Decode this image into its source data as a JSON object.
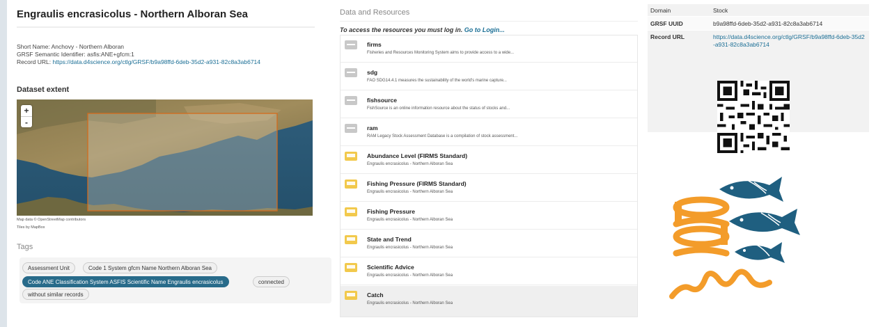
{
  "left": {
    "title": "Engraulis encrasicolus - Northern Alboran Sea",
    "short_name": "Short Name: Anchovy - Northern Alboran",
    "semantic_id": "GRSF Semantic Identifier: asfis:ANE+gfcm:1",
    "record_url_label": "Record URL: ",
    "record_url": "https://data.d4science.org/ctlg/GRSF/b9a98ffd-6deb-35d2-a931-82c8a3ab6714",
    "dataset_extent_heading": "Dataset extent",
    "zoom_in": "+",
    "zoom_out": "-",
    "map_attribution": "Map data © OpenStreetMap contributors",
    "tiles_attribution": "Tiles by MapBox",
    "tags_heading": "Tags",
    "tags": [
      "Assessment Unit",
      "Code 1 System gfcm Name Northern Alboran Sea",
      "Code ANE Classification System ASFIS Scientific Name Engraulis encrasicolus",
      "connected",
      "without similar records"
    ]
  },
  "middle": {
    "heading": "Data and Resources",
    "login_text": "To access the resources you must log in.",
    "login_link": "Go to Login...",
    "resources": [
      {
        "title": "firms",
        "desc": "Fisheries and Resources Monitoring System aims to provide access to a wide...",
        "icon": "grey-doc-icon"
      },
      {
        "title": "sdg",
        "desc": "FAO SDG14.4.1 measures the sustainability of the world's marine capture...",
        "icon": "grey-doc-icon"
      },
      {
        "title": "fishsource",
        "desc": "FishSource is an online information resource about the status of stocks and...",
        "icon": "grey-doc-icon"
      },
      {
        "title": "ram",
        "desc": "RAM Legacy Stock Assessment Database is a compilation of stock assessment...",
        "icon": "grey-doc-icon"
      },
      {
        "title": "Abundance Level (FIRMS Standard)",
        "desc": "Engraulis encrasicolus - Northern Alboran Sea",
        "icon": "yellow-doc-icon"
      },
      {
        "title": "Fishing Pressure (FIRMS Standard)",
        "desc": "Engraulis encrasicolus - Northern Alboran Sea",
        "icon": "yellow-doc-icon"
      },
      {
        "title": "Fishing Pressure",
        "desc": "Engraulis encrasicolus - Northern Alboran Sea",
        "icon": "yellow-doc-icon"
      },
      {
        "title": "State and Trend",
        "desc": "Engraulis encrasicolus - Northern Alboran Sea",
        "icon": "yellow-doc-icon"
      },
      {
        "title": "Scientific Advice",
        "desc": "Engraulis encrasicolus - Northern Alboran Sea",
        "icon": "yellow-doc-icon"
      },
      {
        "title": "Catch",
        "desc": "Engraulis encrasicolus - Northern Alboran Sea",
        "icon": "yellow-doc-icon"
      }
    ]
  },
  "right": {
    "domain_label": "Domain",
    "domain_value": "Stock",
    "uuid_label": "GRSF UUID",
    "uuid_value": "b9a98ffd-6deb-35d2-a931-82c8a3ab6714",
    "record_url_label": "Record URL",
    "record_url_value": "https://data.d4science.org/ctlg/GRSF/b9a98ffd-6deb-35d2-a931-82c8a3ab6714"
  },
  "colors": {
    "link": "#1a6e95",
    "active_tag": "#286b8a",
    "logo_orange": "#f39c2a",
    "logo_blue": "#1f5f80"
  }
}
